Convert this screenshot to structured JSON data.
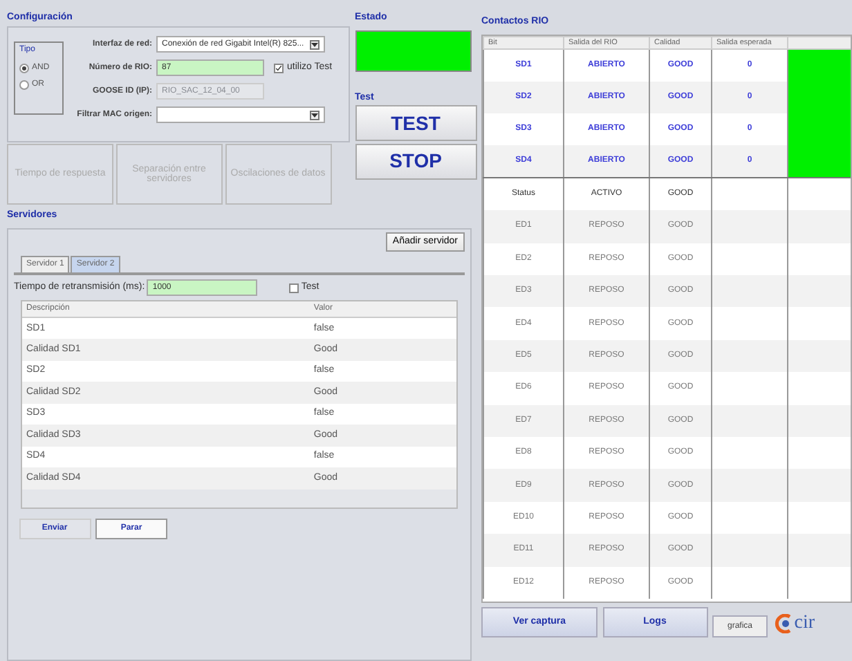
{
  "configuracion": {
    "title": "Configuración",
    "tipo": {
      "title": "Tipo",
      "options": [
        {
          "label": "AND",
          "selected": true
        },
        {
          "label": "OR",
          "selected": false
        }
      ]
    },
    "interfaz": {
      "label": "Interfaz de red:",
      "value": "Conexión de red Gigabit Intel(R) 825..."
    },
    "numero": {
      "label": "Número de RIO:",
      "value": "87"
    },
    "utilizo_test": {
      "label": "utilizo Test",
      "checked": true
    },
    "goose": {
      "label": "GOOSE ID (IP):",
      "value": "RIO_SAC_12_04_00",
      "disabled": true
    },
    "filtrar": {
      "label": "Filtrar MAC origen:"
    }
  },
  "estado": {
    "title": "Estado",
    "on": true
  },
  "test": {
    "title": "Test",
    "buttons": [
      "TEST",
      "STOP"
    ]
  },
  "analysis_buttons": [
    {
      "label": "Tiempo de respuesta",
      "disabled": true
    },
    {
      "label": "Separación entre servidores",
      "disabled": true
    },
    {
      "label": "Oscilaciones de datos",
      "disabled": true
    }
  ],
  "servidores": {
    "title": "Servidores",
    "add_button": "Añadir servidor",
    "tabs": [
      {
        "label": "Servidor 1",
        "selected": false
      },
      {
        "label": "Servidor 2",
        "selected": true
      }
    ],
    "retransmision": {
      "label": "Tiempo de retransmisión (ms):",
      "value": "1000"
    },
    "test_check": {
      "label": "Test",
      "checked": false
    },
    "table": {
      "columns": [
        "Descripción",
        "Valor"
      ],
      "rows": [
        [
          "SD1",
          "false"
        ],
        [
          "Calidad SD1",
          "Good"
        ],
        [
          "SD2",
          "false"
        ],
        [
          "Calidad SD2",
          "Good"
        ],
        [
          "SD3",
          "false"
        ],
        [
          "Calidad SD3",
          "Good"
        ],
        [
          "SD4",
          "false"
        ],
        [
          "Calidad SD4",
          "Good"
        ]
      ]
    },
    "buttons": [
      "Enviar",
      "Parar"
    ]
  },
  "contactos": {
    "title": "Contactos RIO",
    "columns": [
      "Bit",
      "Salida del RIO",
      "Calidad",
      "Salida esperada"
    ],
    "rows": [
      {
        "kind": "output",
        "cells": [
          "SD1",
          "ABIERTO",
          "GOOD",
          "0"
        ],
        "match": true
      },
      {
        "kind": "output",
        "cells": [
          "SD2",
          "ABIERTO",
          "GOOD",
          "0"
        ],
        "match": true
      },
      {
        "kind": "output",
        "cells": [
          "SD3",
          "ABIERTO",
          "GOOD",
          "0"
        ],
        "match": true
      },
      {
        "kind": "output",
        "cells": [
          "SD4",
          "ABIERTO",
          "GOOD",
          "0"
        ],
        "match": true
      },
      {
        "kind": "status",
        "cells": [
          "Status",
          "ACTIVO",
          "GOOD"
        ],
        "match": false
      },
      {
        "kind": "input",
        "cells": [
          "ED1",
          "REPOSO",
          "GOOD"
        ],
        "match": false
      },
      {
        "kind": "input",
        "cells": [
          "ED2",
          "REPOSO",
          "GOOD"
        ],
        "match": false
      },
      {
        "kind": "input",
        "cells": [
          "ED3",
          "REPOSO",
          "GOOD"
        ],
        "match": false
      },
      {
        "kind": "input",
        "cells": [
          "ED4",
          "REPOSO",
          "GOOD"
        ],
        "match": false
      },
      {
        "kind": "input",
        "cells": [
          "ED5",
          "REPOSO",
          "GOOD"
        ],
        "match": false
      },
      {
        "kind": "input",
        "cells": [
          "ED6",
          "REPOSO",
          "GOOD"
        ],
        "match": false
      },
      {
        "kind": "input",
        "cells": [
          "ED7",
          "REPOSO",
          "GOOD"
        ],
        "match": false
      },
      {
        "kind": "input",
        "cells": [
          "ED8",
          "REPOSO",
          "GOOD"
        ],
        "match": false
      },
      {
        "kind": "input",
        "cells": [
          "ED9",
          "REPOSO",
          "GOOD"
        ],
        "match": false
      },
      {
        "kind": "input",
        "cells": [
          "ED10",
          "REPOSO",
          "GOOD"
        ],
        "match": false
      },
      {
        "kind": "input",
        "cells": [
          "ED11",
          "REPOSO",
          "GOOD"
        ],
        "match": false
      },
      {
        "kind": "input",
        "cells": [
          "ED12",
          "REPOSO",
          "GOOD"
        ],
        "match": false
      }
    ]
  },
  "bottom_buttons": [
    "Ver captura",
    "Logs",
    "grafica"
  ],
  "logo_text": "cir"
}
